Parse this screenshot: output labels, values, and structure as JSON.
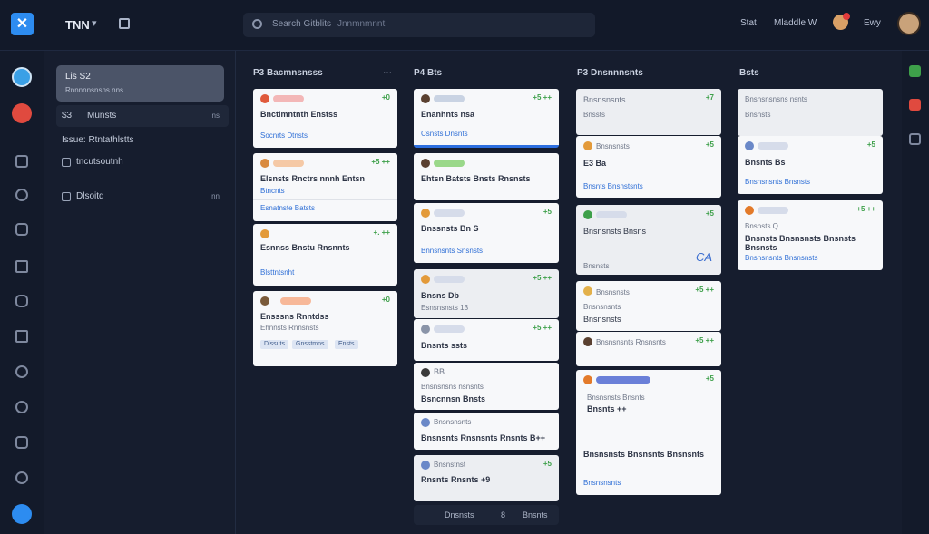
{
  "topbar": {
    "workspace": "TNN",
    "search_placeholder": "Search Gitblits",
    "search_hint": "Jnnmnmnnt",
    "links": [
      "Stat",
      "Mladdle W",
      "Ewy"
    ]
  },
  "sidepanel": {
    "active": {
      "title": "Lis S2",
      "subtitle": "Rnnnnnsnsns nns"
    },
    "items": [
      {
        "label": "Munsts",
        "count": "ns",
        "prefix": "$3"
      },
      {
        "label": "Issue: Rtntathlstts"
      },
      {
        "label": "tncutsoutnh"
      },
      {
        "label": "Dlsoitd",
        "count": "nn"
      }
    ]
  },
  "columns": [
    {
      "title": "P3 Bacmnsnsss",
      "cards": [
        {
          "title": "Bnctimntnth Enstss",
          "link": "Socnrts Dtnsts",
          "check": "+0"
        },
        {
          "title": "Elsnsts Rnctrs nnnh Entsn",
          "link": "Btncnts",
          "meta": "Esnatnste Batsts",
          "check": "+5 ++"
        },
        {
          "title": "Esnnss Bnstu Rnsnnts",
          "link": "Blsttntsnht",
          "check": "+. ++"
        },
        {
          "title": "Ensssns Rnntdss",
          "meta": "Ehnnsts Rnnsnsts",
          "chips": [
            "Dlssuts",
            "Gnsstmns",
            "Ensts"
          ],
          "check": "+0"
        }
      ]
    },
    {
      "title": "P4 Bts",
      "cards": [
        {
          "title": "Enanhnts nsa",
          "link": "Csnsts Dnsnts",
          "check": "+5 ++"
        },
        {
          "title": "Ehtsn Batsts Bnsts Rnsnsts",
          "check": ""
        },
        {
          "title": "Bnssnsts Bn S",
          "link": "Bnnsnsnts Snsnsts",
          "check": "+5"
        },
        {
          "title": "Bnsns Db",
          "meta": "Esnsnsnsts 13",
          "check": "+5 ++"
        },
        {
          "title": "Bnsnts ssts",
          "check": "+5 ++"
        },
        {
          "title": "BB",
          "meta": "Bnsnsnsns nsnsnts",
          "sub": "Bsncnnsn Bnsts",
          "check": ""
        },
        {
          "title": "Bnsnsnts Rnsnsnts Rnsnts B++",
          "meta": "Bnsnsnsnts",
          "check": ""
        },
        {
          "title": "Rnsnts Rnsnts +9",
          "meta": "Bnsnstnst",
          "check": "+5"
        }
      ],
      "footer": {
        "label": "Dnsnsts",
        "count": "8",
        "extra": "Bnsnts"
      }
    },
    {
      "title": "P3 Dnsnnnsnts",
      "cards": [
        {
          "title": "Bnsnsnsnts",
          "meta": "Bnssts",
          "check": "+7"
        },
        {
          "title": "Bnsnsnsts",
          "sub": "E3 Ba",
          "link": "Bnsnts Bnsnstsnts",
          "check": "+5"
        },
        {
          "title": "Bnsnsnsts Bnsns",
          "meta": "Bnsnsts",
          "accent": "CA",
          "check": "+5"
        },
        {
          "title": "Bnsnsnsts",
          "meta": "Bnsnsnsnts",
          "sub": "Bnsnsnsts",
          "check": "+5 ++"
        },
        {
          "title": "Bnsnsnsnts Rnsnsnts",
          "check": "+5 ++"
        },
        {
          "title": "Bnsnts ++",
          "meta": "Bnsnsnsts Bnsnts",
          "sub": "Bnsnsnsts Bnsnsnts Bnsnsnts",
          "link": "Bnsnsnsnts",
          "check": "+5"
        }
      ]
    },
    {
      "title": "Bsts",
      "cards": [
        {
          "title": "Bnsnsnsnsns nsnts",
          "meta": "Bnsnsts",
          "check": ""
        },
        {
          "title": "Bnsnts Bs",
          "link": "Bnsnsnsnts Bnsnsts",
          "check": "+5"
        },
        {
          "title": "Bnsnsts Bnsnsnsts Bnsnsts Bnsnsts",
          "sub": "Bnsnsts Q",
          "link": "Bnsnsnsnts Bnsnsnsts",
          "check": "+5 ++"
        }
      ]
    }
  ],
  "colors": {
    "accent": "#2d8cf0",
    "bg": "#161d2e",
    "card": "#f7f8fa",
    "link": "#2f6fd6",
    "ok": "#3ea04a"
  }
}
